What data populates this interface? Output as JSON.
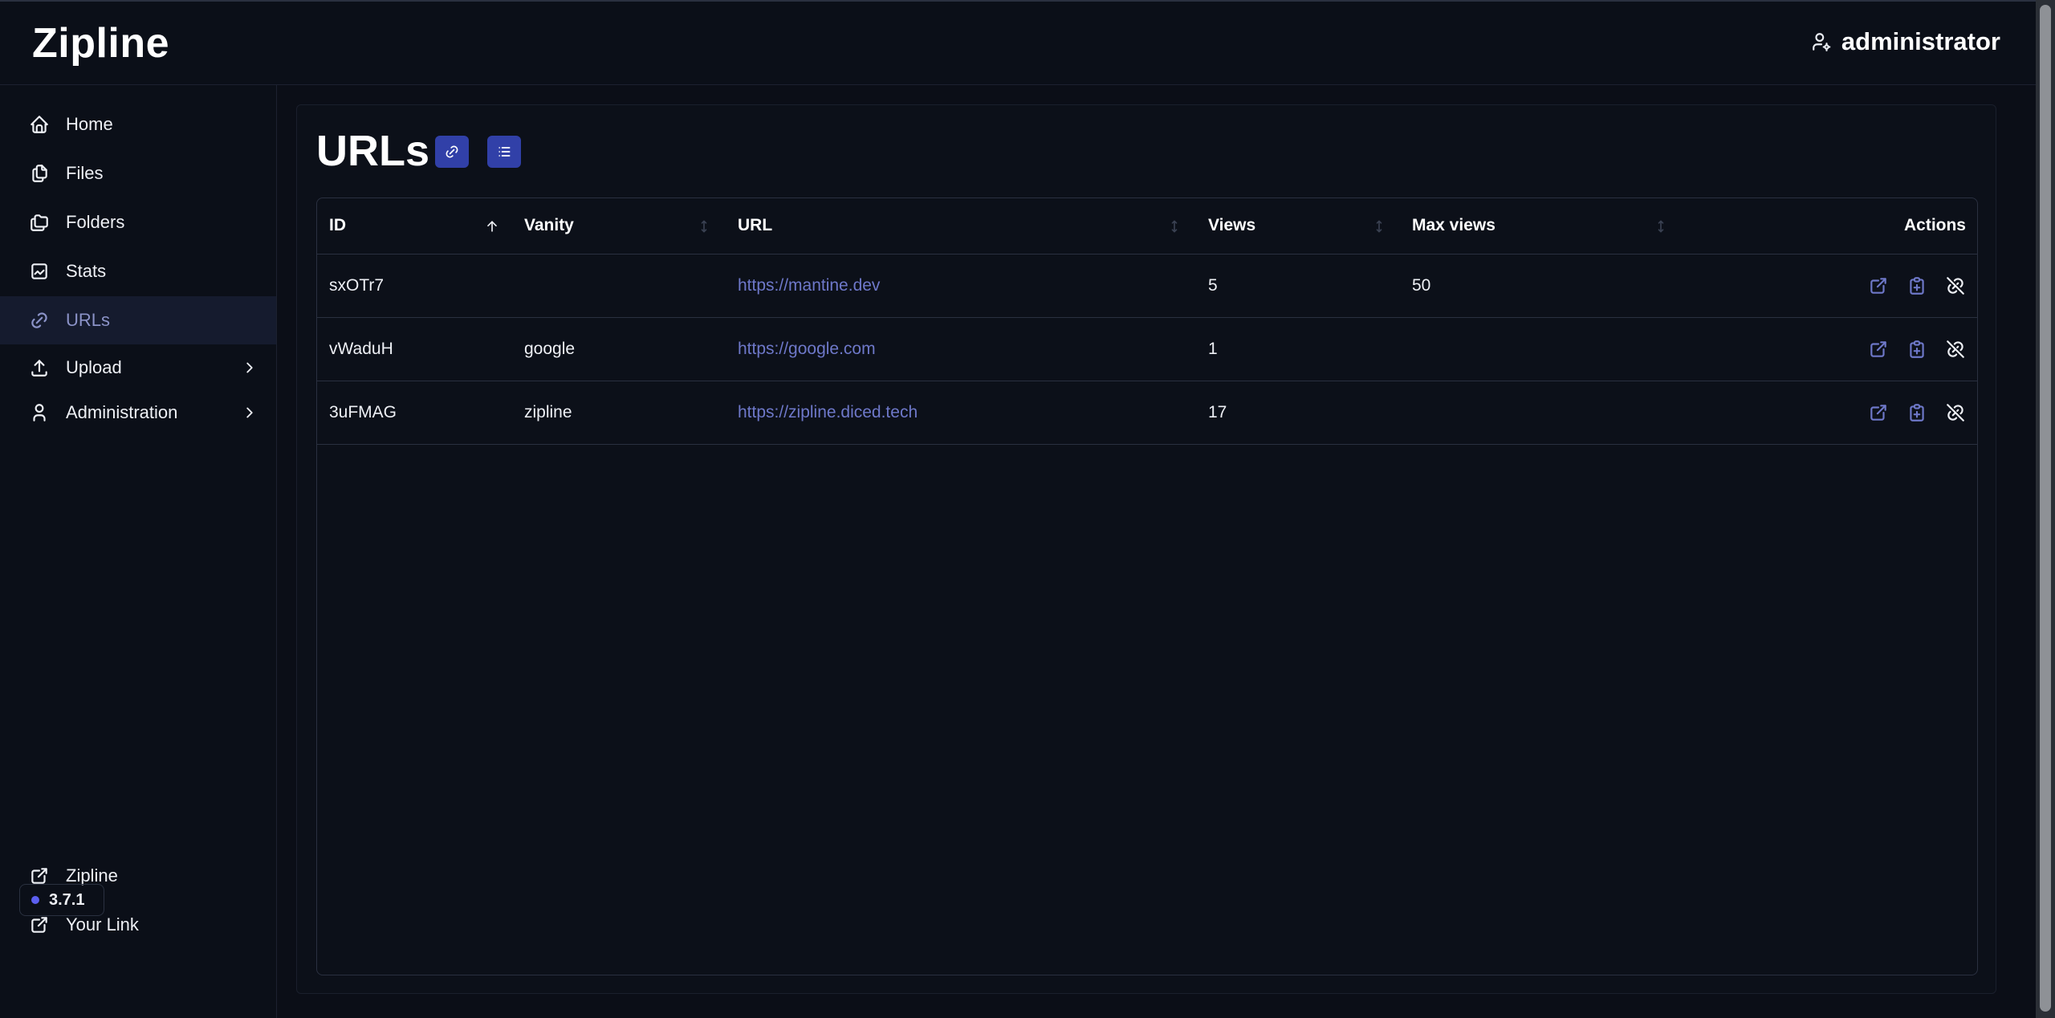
{
  "app": {
    "title": "Zipline",
    "username": "administrator"
  },
  "sidebar": {
    "items": [
      {
        "label": "Home",
        "icon": "home-icon"
      },
      {
        "label": "Files",
        "icon": "files-icon"
      },
      {
        "label": "Folders",
        "icon": "folders-icon"
      },
      {
        "label": "Stats",
        "icon": "stats-icon"
      },
      {
        "label": "URLs",
        "icon": "link-icon",
        "active": true
      },
      {
        "label": "Upload",
        "icon": "upload-icon",
        "expandable": true
      },
      {
        "label": "Administration",
        "icon": "user-icon",
        "expandable": true
      }
    ],
    "bottom_links": [
      {
        "label": "Zipline",
        "icon": "external-link-icon"
      },
      {
        "label": "Your Link",
        "icon": "external-link-icon"
      }
    ],
    "version": "3.7.1"
  },
  "page": {
    "title": "URLs"
  },
  "table": {
    "columns": [
      "ID",
      "Vanity",
      "URL",
      "Views",
      "Max views",
      "Actions"
    ],
    "sorted_column": "ID",
    "sort_direction": "ascending",
    "rows": [
      {
        "id": "sxOTr7",
        "vanity": "",
        "url": "https://mantine.dev",
        "views": "5",
        "max_views": "50"
      },
      {
        "id": "vWaduH",
        "vanity": "google",
        "url": "https://google.com",
        "views": "1",
        "max_views": ""
      },
      {
        "id": "3uFMAG",
        "vanity": "zipline",
        "url": "https://zipline.diced.tech",
        "views": "17",
        "max_views": ""
      }
    ]
  },
  "colors": {
    "accent": "#3140a8",
    "link": "#6e78c9",
    "background": "#0b0e17"
  }
}
